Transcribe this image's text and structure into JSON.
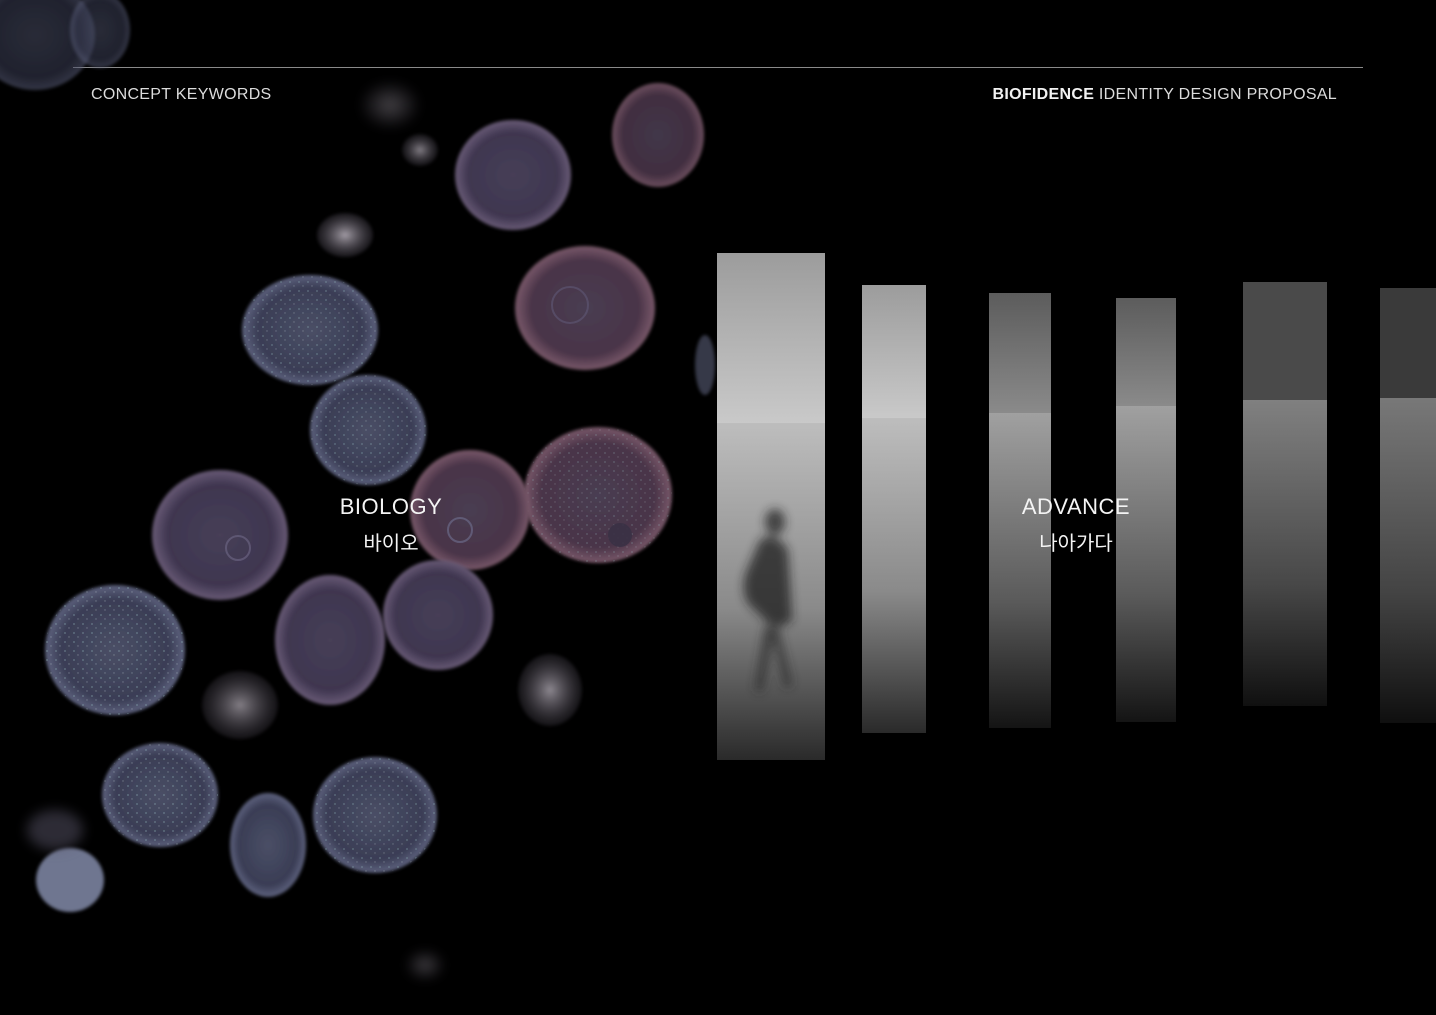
{
  "header": {
    "left_title": "CONCEPT KEYWORDS",
    "brand": "BIOFIDENCE",
    "right_title": " IDENTITY DESIGN PROPOSAL"
  },
  "keywords": [
    {
      "en": "BIOLOGY",
      "ko": "바이오"
    },
    {
      "en": "ADVANCE",
      "ko": "나아가다"
    }
  ]
}
